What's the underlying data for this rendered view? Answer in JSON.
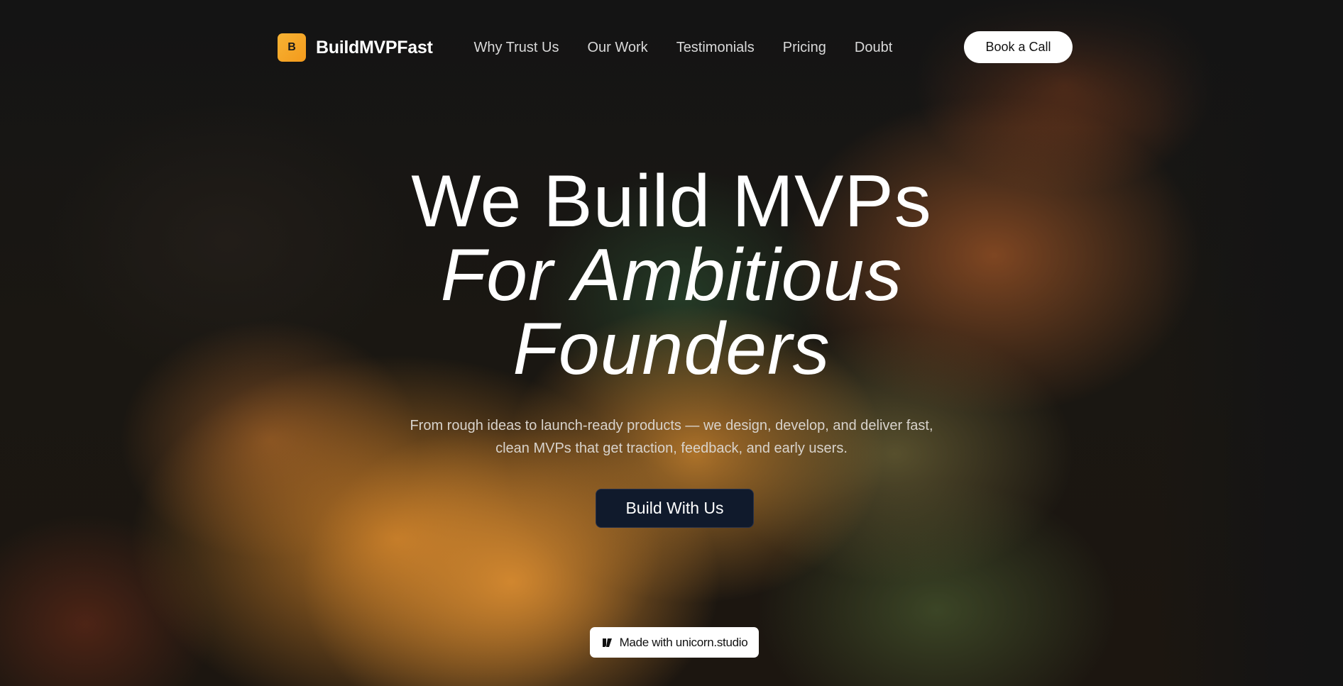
{
  "brand": {
    "logo_letter": "B",
    "name": "BuildMVPFast",
    "logo_color": "#f5a623"
  },
  "nav": {
    "links": [
      "Why Trust Us",
      "Our Work",
      "Testimonials",
      "Pricing",
      "Doubt"
    ],
    "cta_label": "Book a Call"
  },
  "hero": {
    "title_line1": "We Build MVPs",
    "title_line2": "For Ambitious",
    "title_line3": "Founders",
    "subtitle_line1": "From rough ideas to launch-ready products — we design, develop, and deliver fast,",
    "subtitle_line2": "clean MVPs that get traction, feedback, and early users.",
    "cta_label": "Build With Us"
  },
  "badge": {
    "label": "Made with unicorn.studio"
  },
  "colors": {
    "background": "#151515",
    "accent_orange": "#d08a35",
    "cta_bg": "#101a2c"
  }
}
